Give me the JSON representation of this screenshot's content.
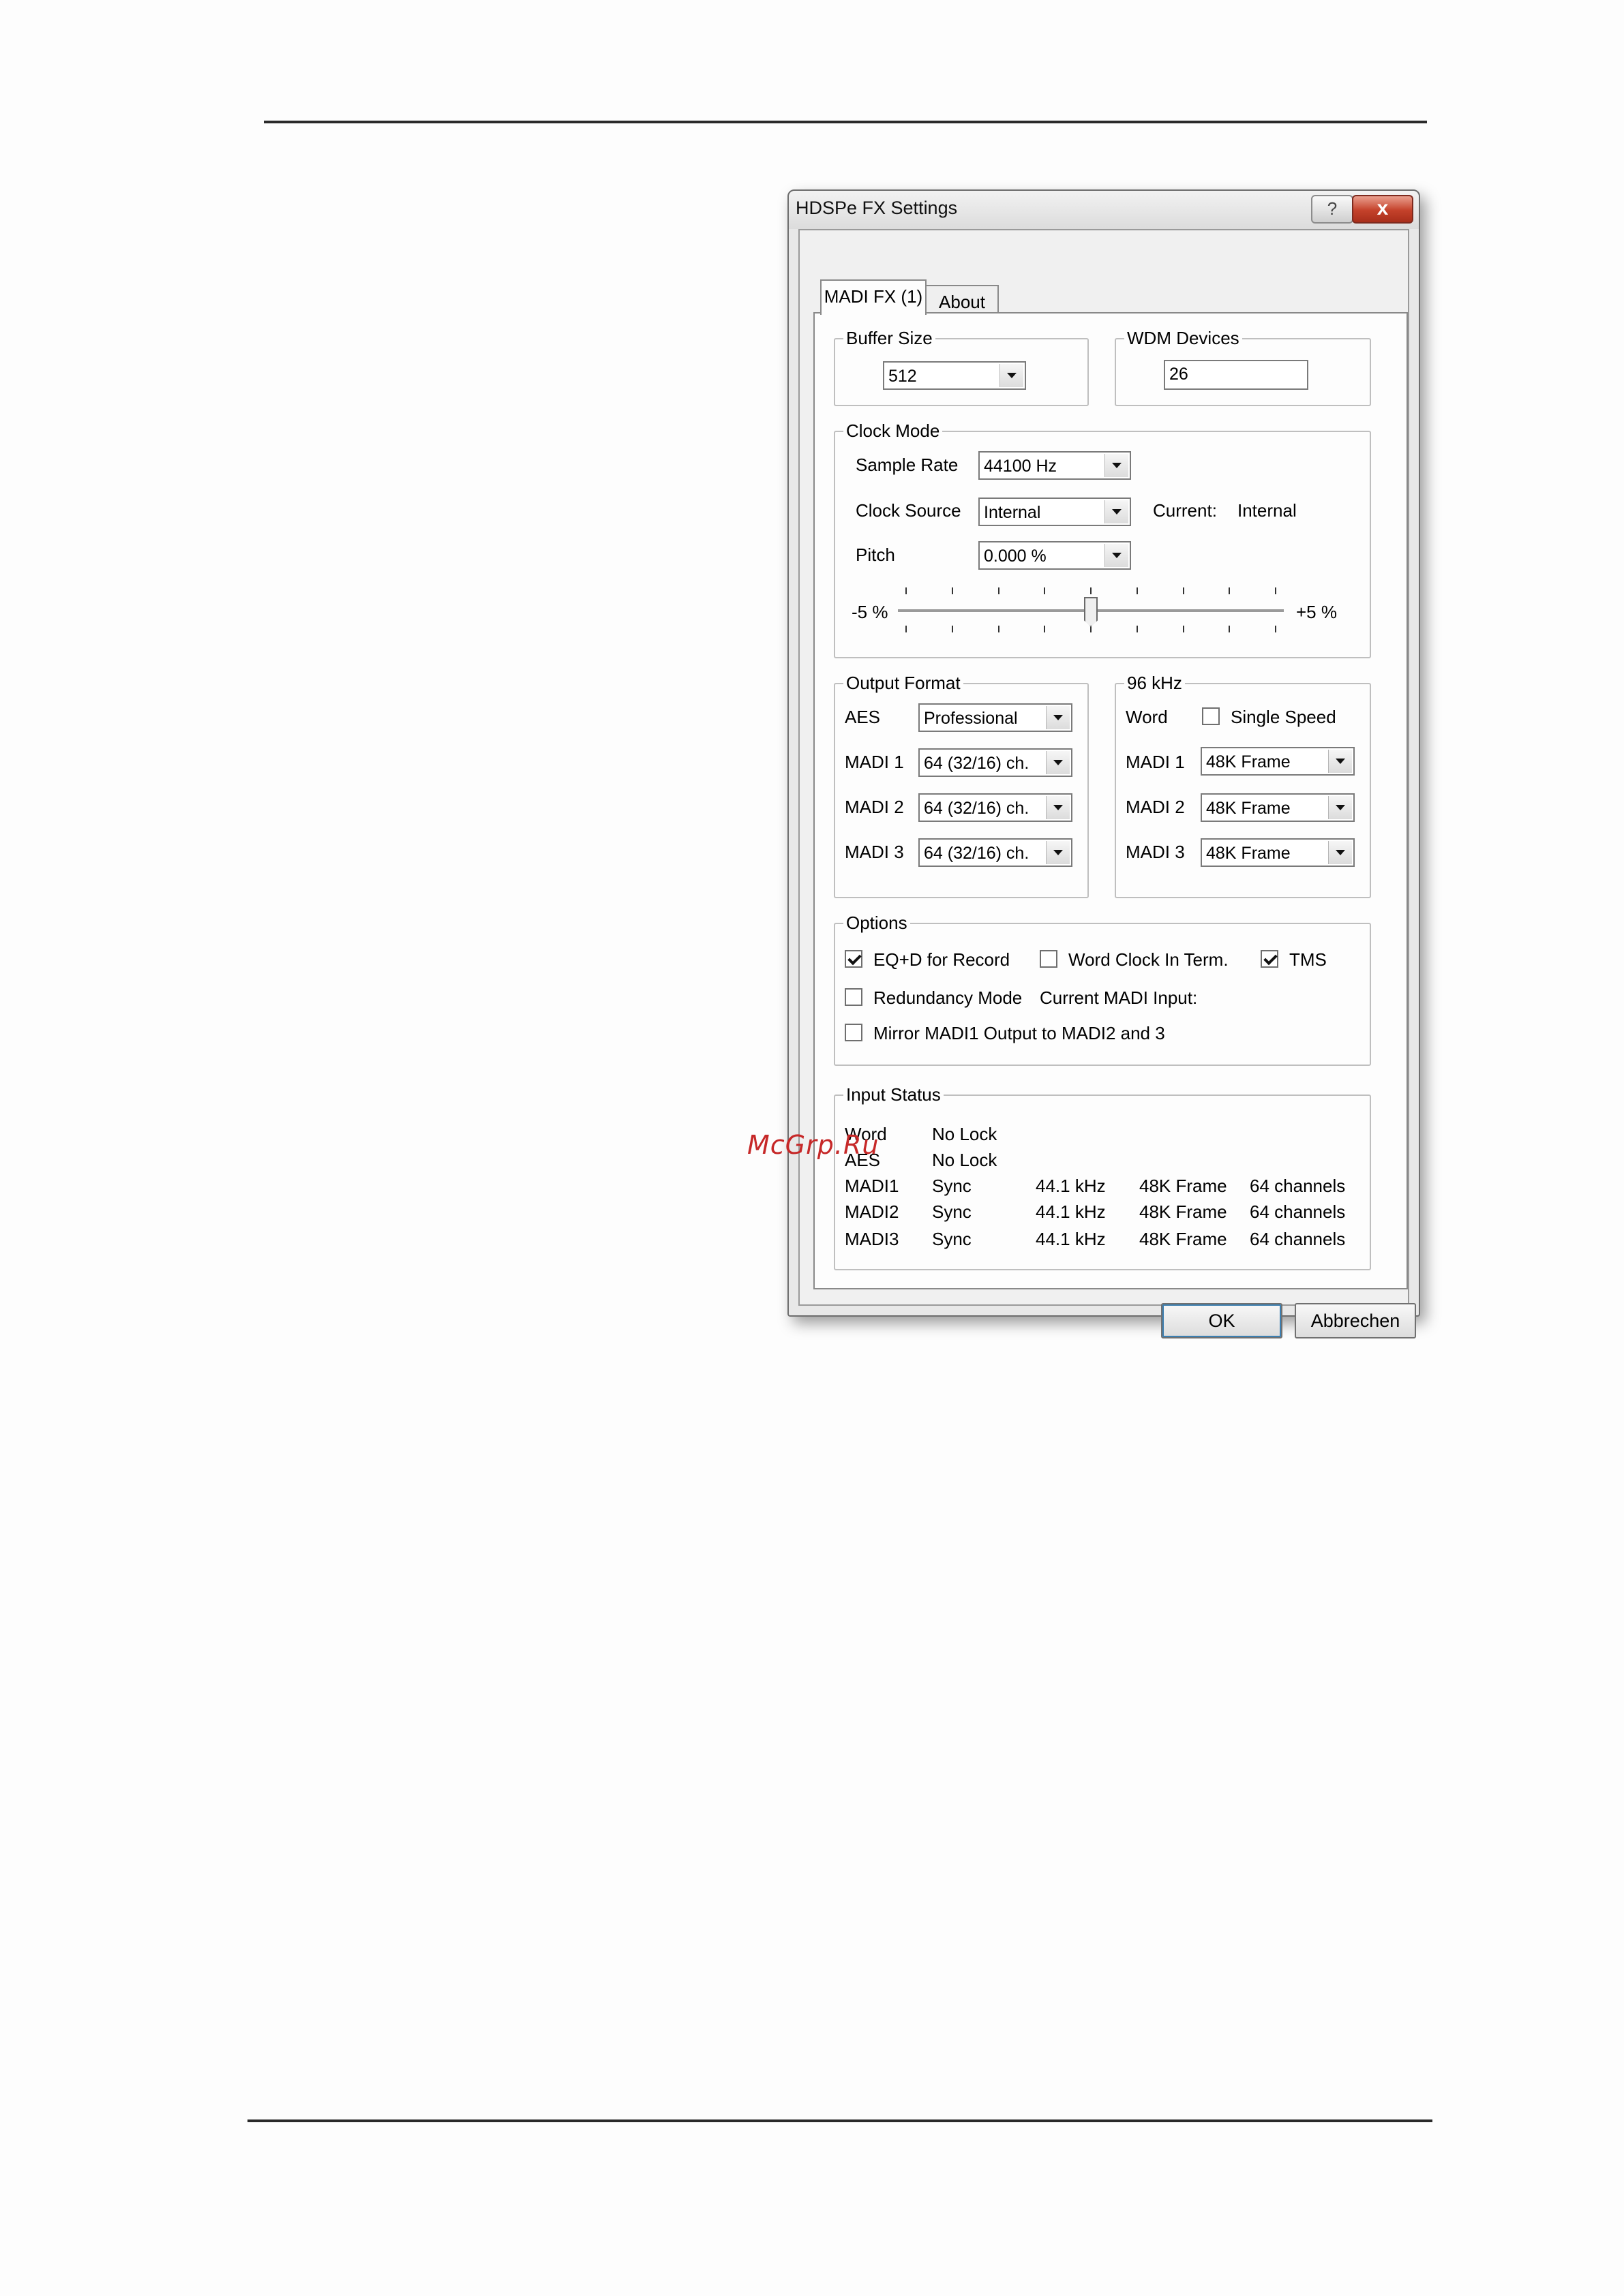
{
  "dialog": {
    "title": "HDSPe FX Settings",
    "help_label": "?",
    "close_label": "x",
    "tabs": [
      {
        "label": "MADI FX (1)",
        "active": true
      },
      {
        "label": "About",
        "active": false
      }
    ],
    "buffer_size": {
      "label": "Buffer Size",
      "value": "512"
    },
    "wdm_devices": {
      "label": "WDM Devices",
      "value": "26"
    },
    "clock_mode": {
      "label": "Clock Mode",
      "sample_rate_label": "Sample Rate",
      "sample_rate_value": "44100 Hz",
      "clock_source_label": "Clock Source",
      "clock_source_value": "Internal",
      "current_label": "Current:",
      "current_value": "Internal",
      "pitch_label": "Pitch",
      "pitch_value": "0.000 %",
      "slider_min_label": "-5 %",
      "slider_max_label": "+5 %",
      "slider_position_fraction": 0.5
    },
    "output_format": {
      "label": "Output Format",
      "rows": [
        {
          "label": "AES",
          "value": "Professional"
        },
        {
          "label": "MADI 1",
          "value": "64 (32/16) ch."
        },
        {
          "label": "MADI 2",
          "value": "64 (32/16) ch."
        },
        {
          "label": "MADI 3",
          "value": "64 (32/16) ch."
        }
      ]
    },
    "khz96": {
      "label": "96 kHz",
      "word_label": "Word",
      "single_speed_label": "Single Speed",
      "single_speed_checked": false,
      "rows": [
        {
          "label": "MADI 1",
          "value": "48K Frame"
        },
        {
          "label": "MADI 2",
          "value": "48K Frame"
        },
        {
          "label": "MADI 3",
          "value": "48K Frame"
        }
      ]
    },
    "options": {
      "label": "Options",
      "eqd_label": "EQ+D for Record",
      "eqd_checked": true,
      "word_term_label": "Word Clock In Term.",
      "word_term_checked": false,
      "tms_label": "TMS",
      "tms_checked": true,
      "redundancy_label": "Redundancy Mode",
      "redundancy_checked": false,
      "current_madi_label": "Current MADI Input:",
      "mirror_label": "Mirror MADI1 Output to MADI2 and 3",
      "mirror_checked": false
    },
    "input_status": {
      "label": "Input Status",
      "rows": [
        {
          "name": "Word",
          "state": "No Lock",
          "freq": "",
          "frame": "",
          "channels": ""
        },
        {
          "name": "AES",
          "state": "No Lock",
          "freq": "",
          "frame": "",
          "channels": ""
        },
        {
          "name": "MADI1",
          "state": "Sync",
          "freq": "44.1 kHz",
          "frame": "48K Frame",
          "channels": "64 channels"
        },
        {
          "name": "MADI2",
          "state": "Sync",
          "freq": "44.1 kHz",
          "frame": "48K Frame",
          "channels": "64 channels"
        },
        {
          "name": "MADI3",
          "state": "Sync",
          "freq": "44.1 kHz",
          "frame": "48K Frame",
          "channels": "64 channels"
        }
      ]
    },
    "ok_label": "OK",
    "cancel_label": "Abbrechen"
  },
  "watermark": "McGrp.Ru"
}
